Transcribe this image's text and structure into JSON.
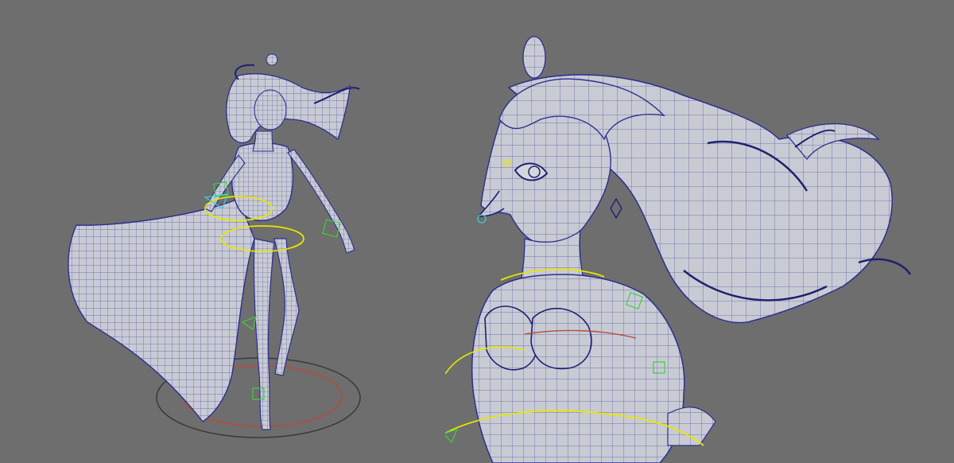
{
  "viewport": {
    "background": "#6e6e6e",
    "mesh_surface_color": "#c9cbd4",
    "wire_color": "#2b2f8f",
    "rig_colors": {
      "selection": "#e6e600",
      "controller_green": "#3fcf3f",
      "controller_cyan": "#3fcfcf",
      "ground_ring_red": "#b84a3a",
      "ground_ring_dark": "#3a3a3a"
    }
  },
  "panes": {
    "left": {
      "subject": "full-body-character",
      "view": "perspective"
    },
    "right": {
      "subject": "bust-closeup",
      "view": "perspective"
    }
  }
}
